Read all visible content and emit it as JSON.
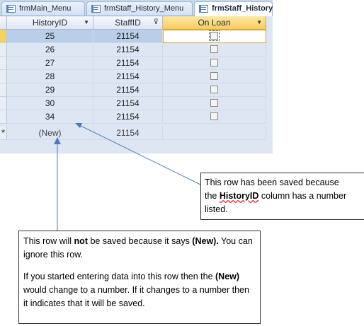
{
  "tabs": [
    {
      "label": "frmMain_Menu",
      "active": false
    },
    {
      "label": "frmStaff_History_Menu",
      "active": false
    },
    {
      "label": "frmStaff_History",
      "active": true
    }
  ],
  "columns": {
    "history_id": "HistoryID",
    "staff_id": "StaffID",
    "on_loan": "On Loan"
  },
  "rows": [
    {
      "history_id": "25",
      "staff_id": "21154",
      "on_loan": false
    },
    {
      "history_id": "26",
      "staff_id": "21154",
      "on_loan": false
    },
    {
      "history_id": "27",
      "staff_id": "21154",
      "on_loan": false
    },
    {
      "history_id": "28",
      "staff_id": "21154",
      "on_loan": false
    },
    {
      "history_id": "29",
      "staff_id": "21154",
      "on_loan": false
    },
    {
      "history_id": "30",
      "staff_id": "21154",
      "on_loan": false
    },
    {
      "history_id": "34",
      "staff_id": "21154",
      "on_loan": false
    }
  ],
  "new_row": {
    "marker": "*",
    "history_id": "(New)",
    "staff_id": "21154"
  },
  "callout_saved": {
    "line1": "This row has been saved because",
    "line2_pre": "the ",
    "line2_bold": "HistoryID",
    "line2_post": " column has a number",
    "line3": "listed."
  },
  "callout_new": {
    "p1_a": "This row will ",
    "p1_bold1": "not",
    "p1_b": " be saved because it says ",
    "p1_bold2": "(New).",
    "p1_c": " You can ignore this row.",
    "p2_a": "If you started entering data into this row then the ",
    "p2_bold": "(New)",
    "p2_b": " would change to a number. If it changes to a number then it indicates that it will be saved."
  },
  "colors": {
    "accent": "#f6d15c",
    "selected_row": "#b9cfe9",
    "arrow": "#4a7ab8"
  }
}
